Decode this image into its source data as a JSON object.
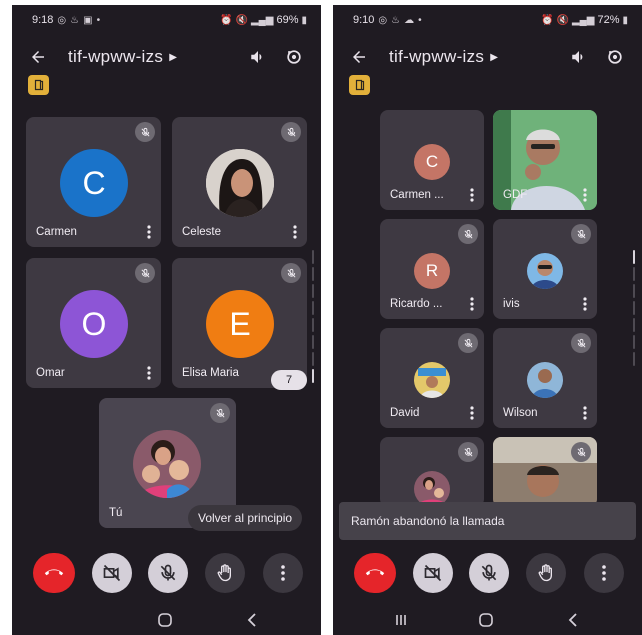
{
  "left": {
    "status": {
      "time": "9:18",
      "battery": "69%"
    },
    "meeting_title": "tif-wpww-izs",
    "tiles": [
      {
        "name": "Carmen",
        "initial": "C",
        "avatar_color": "#1a73c9"
      },
      {
        "name": "Celeste",
        "initial": "",
        "avatar_color": "#2b2b2b"
      },
      {
        "name": "Omar",
        "initial": "O",
        "avatar_color": "#8d55d6"
      },
      {
        "name": "Elisa Maria",
        "initial": "E",
        "avatar_color": "#f07d12"
      },
      {
        "name": "Tú",
        "initial": "",
        "avatar_color": "#7a3a6a"
      }
    ],
    "hidden_count": "7",
    "back_to_top_label": "Volver al principio"
  },
  "right": {
    "status": {
      "time": "9:10",
      "battery": "72%"
    },
    "meeting_title": "tif-wpww-izs",
    "tiles": [
      {
        "name": "Carmen ...",
        "initial": "C",
        "avatar_color": "#c47566"
      },
      {
        "name": "GDF",
        "initial": "",
        "avatar_color": "#5aa14a"
      },
      {
        "name": "Ricardo ...",
        "initial": "R",
        "avatar_color": "#c47566"
      },
      {
        "name": "ivis",
        "initial": "",
        "avatar_color": "#3c8ad0"
      },
      {
        "name": "David",
        "initial": "",
        "avatar_color": "#c9a84a"
      },
      {
        "name": "Wilson",
        "initial": "",
        "avatar_color": "#3b73b8"
      },
      {
        "name": "",
        "initial": "",
        "avatar_color": "#7a3a6a"
      },
      {
        "name": "",
        "initial": "",
        "avatar_color": "#7c6a5a"
      }
    ],
    "snackbar_text": "Ramón abandonó la llamada"
  },
  "icons": {
    "back": "arrow-left-icon",
    "speaker": "speaker-icon",
    "switch_camera": "switch-camera-icon",
    "host": "host-badge-icon",
    "muted": "mic-off-icon",
    "more": "more-vert-icon",
    "end_call": "end-call-icon",
    "camera_off": "camera-off-icon",
    "mic_off": "mic-off-icon",
    "raise_hand": "raise-hand-icon",
    "recents": "recents-icon",
    "home": "home-icon",
    "nav_back": "nav-back-icon"
  },
  "colors": {
    "background": "#1f1b22",
    "tile": "#3e3942",
    "end_call": "#e5252a",
    "host_badge": "#e2b03a",
    "control_light": "#d4cfd8"
  }
}
